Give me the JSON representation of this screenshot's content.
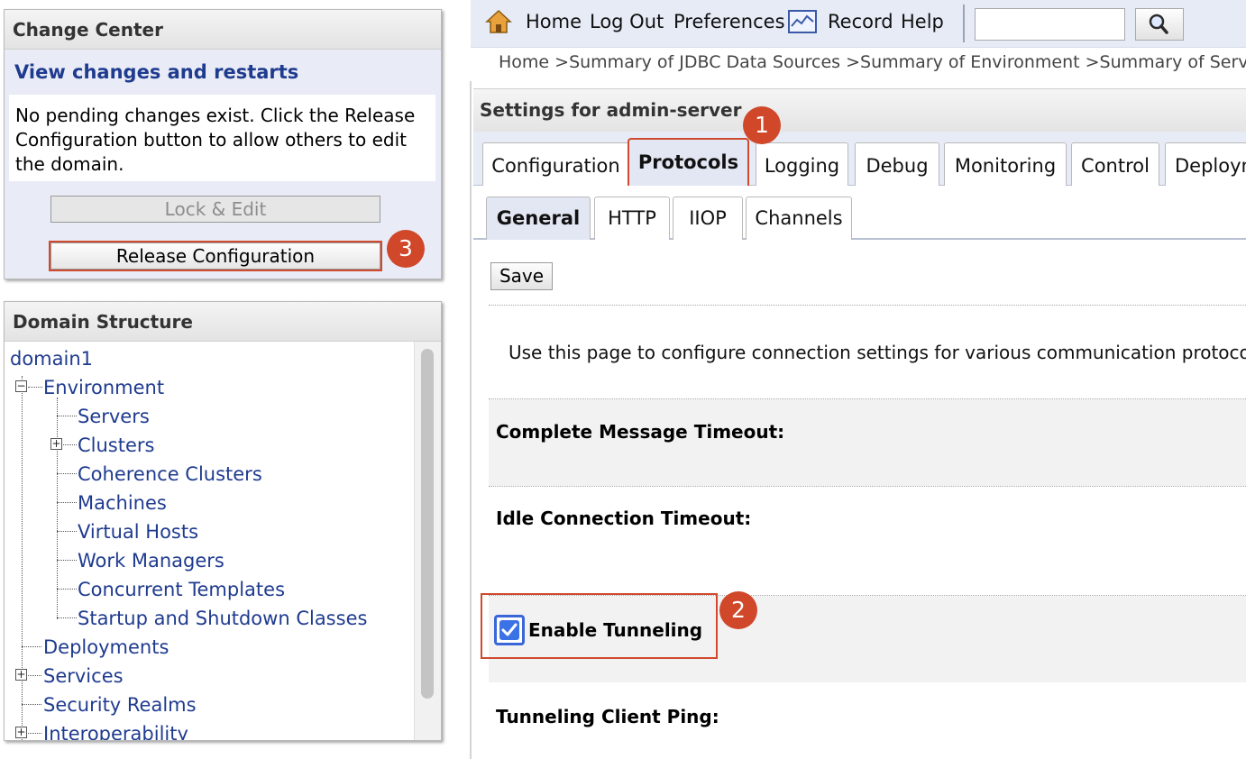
{
  "change_center": {
    "title": "Change Center",
    "subtitle": "View changes and restarts",
    "message": "No pending changes exist. Click the Release Configuration button to allow others to edit the domain.",
    "lock_edit_label": "Lock & Edit",
    "release_label": "Release Configuration"
  },
  "domain_structure": {
    "title": "Domain Structure",
    "items": [
      {
        "label": "domain1"
      },
      {
        "label": "Environment",
        "toggle": "−"
      },
      {
        "label": "Servers"
      },
      {
        "label": "Clusters",
        "toggle": "+"
      },
      {
        "label": "Coherence Clusters"
      },
      {
        "label": "Machines"
      },
      {
        "label": "Virtual Hosts"
      },
      {
        "label": "Work Managers"
      },
      {
        "label": "Concurrent Templates"
      },
      {
        "label": "Startup and Shutdown Classes"
      },
      {
        "label": "Deployments"
      },
      {
        "label": "Services",
        "toggle": "+"
      },
      {
        "label": "Security Realms"
      },
      {
        "label": "Interoperability",
        "toggle": "+"
      }
    ]
  },
  "toolbar": {
    "home": "Home",
    "logout": "Log Out",
    "preferences": "Preferences",
    "record": "Record",
    "help": "Help",
    "search_value": "",
    "icons": {
      "home": "home-icon",
      "record": "record-icon",
      "search": "magnifier-icon"
    }
  },
  "breadcrumb": "Home >Summary of JDBC Data Sources >Summary of Environment >Summary of Servers >a",
  "settings": {
    "title": "Settings for admin-server",
    "tabs": [
      "Configuration",
      "Protocols",
      "Logging",
      "Debug",
      "Monitoring",
      "Control",
      "Deploym"
    ],
    "active_tab": "Protocols",
    "subtabs": [
      "General",
      "HTTP",
      "IIOP",
      "Channels"
    ],
    "active_subtab": "General",
    "save_label": "Save",
    "intro": "Use this page to configure connection settings for various communication protocols t",
    "fields": {
      "complete_message_timeout": "Complete Message Timeout:",
      "idle_connection_timeout": "Idle Connection Timeout:",
      "enable_tunneling": "Enable Tunneling",
      "enable_tunneling_checked": true,
      "tunneling_client_ping": "Tunneling Client Ping:"
    }
  },
  "badges": [
    "1",
    "2",
    "3"
  ],
  "colors": {
    "accent": "#cf4a2e",
    "link": "#1f3b8f",
    "toolbar_bg": "#e6ebf6"
  }
}
